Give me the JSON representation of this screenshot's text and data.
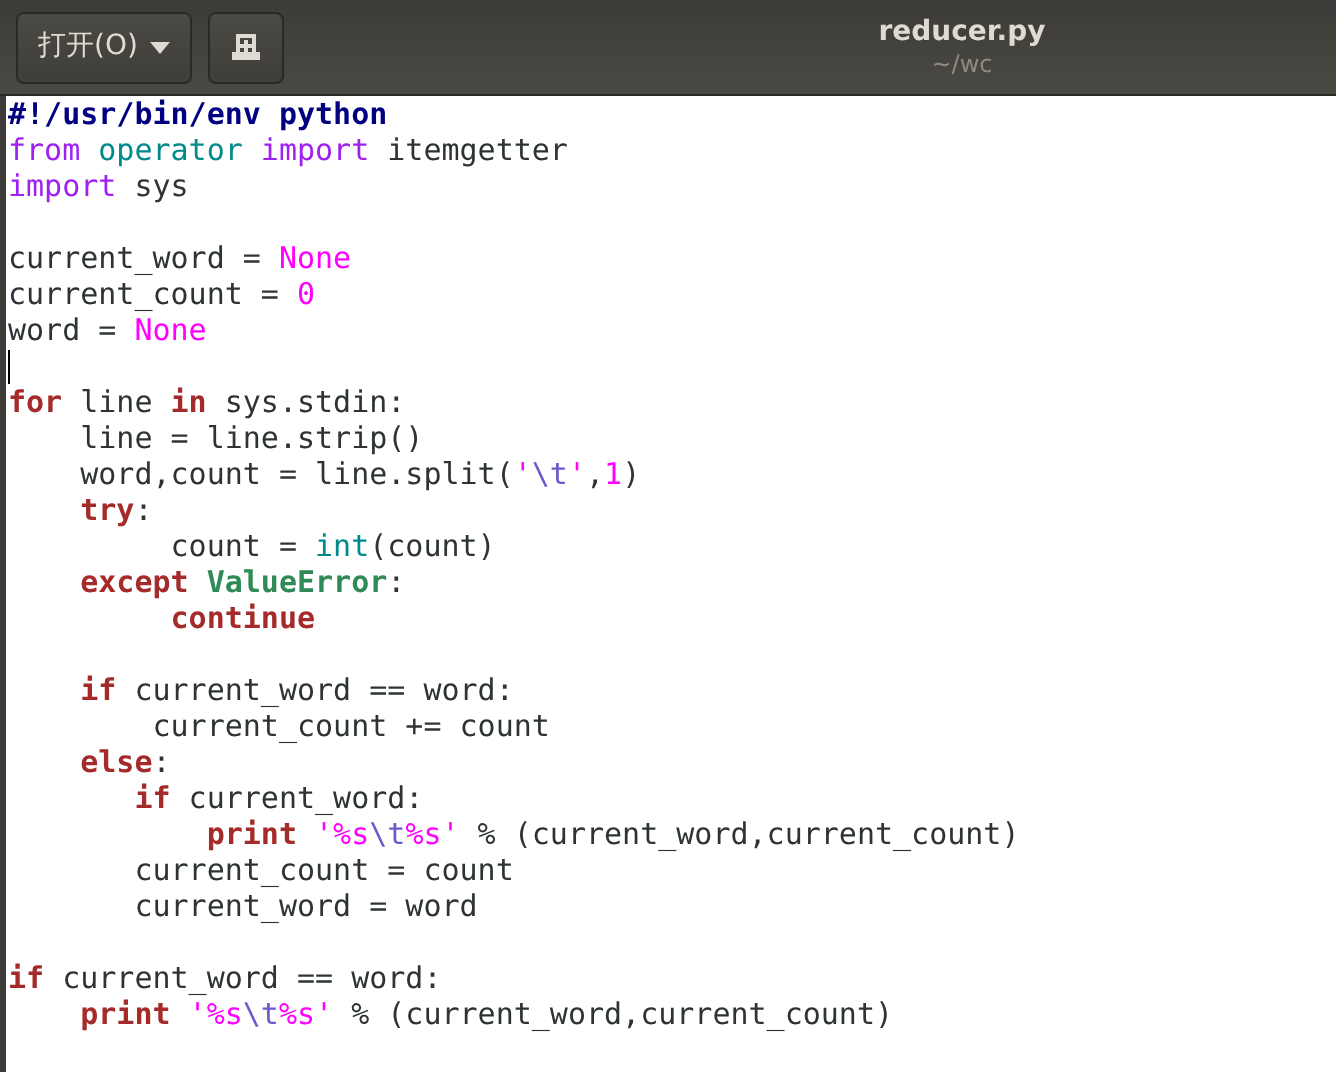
{
  "header": {
    "open_button": "打开(O)",
    "title": "reducer.py",
    "subtitle": "~/wc"
  },
  "lines": [
    {
      "tokens": [
        {
          "kind": "shebang",
          "text": "#!/usr/bin/env python"
        }
      ]
    },
    {
      "tokens": [
        {
          "kind": "import",
          "text": "from"
        },
        {
          "kind": "builtin",
          "text": " operator"
        },
        {
          "kind": "import",
          "text": " import"
        },
        {
          "kind": "plain",
          "text": " itemgetter"
        }
      ]
    },
    {
      "tokens": [
        {
          "kind": "import",
          "text": "import"
        },
        {
          "kind": "plain",
          "text": " sys"
        }
      ]
    },
    {
      "blank_before": true,
      "tokens": [
        {
          "kind": "plain",
          "text": "current_word = "
        },
        {
          "kind": "constant",
          "text": "None"
        }
      ]
    },
    {
      "tokens": [
        {
          "kind": "plain",
          "text": "current_count = "
        },
        {
          "kind": "constant",
          "text": "0"
        }
      ]
    },
    {
      "tokens": [
        {
          "kind": "plain",
          "text": "word = "
        },
        {
          "kind": "constant",
          "text": "None"
        }
      ]
    },
    {
      "cursor": true
    },
    {
      "tokens": [
        {
          "kind": "keyword",
          "text": "for"
        },
        {
          "kind": "plain",
          "text": " line "
        },
        {
          "kind": "keyword",
          "text": "in"
        },
        {
          "kind": "plain",
          "text": " sys.stdin:"
        }
      ]
    },
    {
      "tokens": [
        {
          "kind": "plain",
          "text": "    line = line.strip()"
        }
      ]
    },
    {
      "tokens": [
        {
          "kind": "plain",
          "text": "    word,count = line.split("
        },
        {
          "kind": "constant",
          "text": "'"
        },
        {
          "kind": "escape",
          "text": "\\t"
        },
        {
          "kind": "constant",
          "text": "'"
        },
        {
          "kind": "plain",
          "text": ","
        },
        {
          "kind": "constant",
          "text": "1"
        },
        {
          "kind": "plain",
          "text": ")"
        }
      ]
    },
    {
      "tokens": [
        {
          "kind": "keyword",
          "text": "    try"
        },
        {
          "kind": "plain",
          "text": ":"
        }
      ]
    },
    {
      "tokens": [
        {
          "kind": "plain",
          "text": "         count = "
        },
        {
          "kind": "builtin",
          "text": "int"
        },
        {
          "kind": "plain",
          "text": "(count)"
        }
      ]
    },
    {
      "tokens": [
        {
          "kind": "keyword",
          "text": "    except"
        },
        {
          "kind": "exception",
          "text": " ValueError"
        },
        {
          "kind": "plain",
          "text": ":"
        }
      ]
    },
    {
      "tokens": [
        {
          "kind": "keyword",
          "text": "         continue"
        }
      ]
    },
    {
      "blank_before": true,
      "tokens": [
        {
          "kind": "keyword",
          "text": "    if"
        },
        {
          "kind": "plain",
          "text": " current_word == word:"
        }
      ]
    },
    {
      "tokens": [
        {
          "kind": "plain",
          "text": "        current_count += count"
        }
      ]
    },
    {
      "tokens": [
        {
          "kind": "keyword",
          "text": "    else"
        },
        {
          "kind": "plain",
          "text": ":"
        }
      ]
    },
    {
      "tokens": [
        {
          "kind": "keyword",
          "text": "       if"
        },
        {
          "kind": "plain",
          "text": " current_word:"
        }
      ]
    },
    {
      "tokens": [
        {
          "kind": "keyword",
          "text": "           print"
        },
        {
          "kind": "constant",
          "text": " '%s"
        },
        {
          "kind": "escape",
          "text": "\\t"
        },
        {
          "kind": "constant",
          "text": "%s'"
        },
        {
          "kind": "plain",
          "text": " % (current_word,current_count)"
        }
      ]
    },
    {
      "tokens": [
        {
          "kind": "plain",
          "text": "       current_count = count"
        }
      ]
    },
    {
      "tokens": [
        {
          "kind": "plain",
          "text": "       current_word = word"
        }
      ]
    },
    {
      "blank_before": true,
      "tokens": [
        {
          "kind": "keyword",
          "text": "if"
        },
        {
          "kind": "plain",
          "text": " current_word == word:"
        }
      ]
    },
    {
      "tokens": [
        {
          "kind": "keyword",
          "text": "    print"
        },
        {
          "kind": "constant",
          "text": " '%s"
        },
        {
          "kind": "escape",
          "text": "\\t"
        },
        {
          "kind": "constant",
          "text": "%s'"
        },
        {
          "kind": "plain",
          "text": " % (current_word,current_count)"
        }
      ]
    }
  ]
}
